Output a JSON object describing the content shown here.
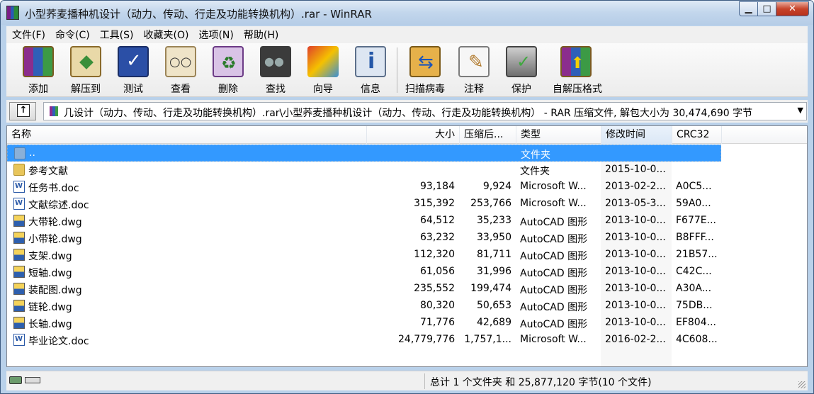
{
  "window": {
    "title": "小型荞麦播种机设计（动力、传动、行走及功能转换机构）.rar - WinRAR",
    "minimize": "▁",
    "maximize": "□",
    "close": "✕"
  },
  "menu": [
    "文件(F)",
    "命令(C)",
    "工具(S)",
    "收藏夹(O)",
    "选项(N)",
    "帮助(H)"
  ],
  "toolbar": [
    {
      "label": "添加",
      "icon": "add-archive-icon"
    },
    {
      "label": "解压到",
      "icon": "extract-icon"
    },
    {
      "label": "测试",
      "icon": "test-icon"
    },
    {
      "label": "查看",
      "icon": "view-icon"
    },
    {
      "label": "删除",
      "icon": "delete-icon"
    },
    {
      "label": "查找",
      "icon": "find-icon"
    },
    {
      "label": "向导",
      "icon": "wizard-icon"
    },
    {
      "label": "信息",
      "icon": "info-icon"
    },
    {
      "label": "扫描病毒",
      "icon": "scan-icon"
    },
    {
      "label": "注释",
      "icon": "comment-icon"
    },
    {
      "label": "保护",
      "icon": "protect-icon"
    },
    {
      "label": "自解压格式",
      "icon": "sfx-icon"
    }
  ],
  "address": {
    "path": "几设计（动力、传动、行走及功能转换机构）.rar\\小型荞麦播种机设计（动力、传动、行走及功能转换机构） - RAR 压缩文件, 解包大小为 30,474,690 字节"
  },
  "columns": {
    "name": "名称",
    "size": "大小",
    "packed": "压缩后...",
    "type": "类型",
    "modified": "修改时间",
    "crc": "CRC32"
  },
  "files": [
    {
      "name": "..",
      "size": "",
      "packed": "",
      "type": "文件夹",
      "modified": "",
      "crc": "",
      "kind": "folder-up"
    },
    {
      "name": "参考文献",
      "size": "",
      "packed": "",
      "type": "文件夹",
      "modified": "2015-10-0...",
      "crc": "",
      "kind": "folder"
    },
    {
      "name": "任务书.doc",
      "size": "93,184",
      "packed": "9,924",
      "type": "Microsoft W...",
      "modified": "2013-02-2...",
      "crc": "A0C5...",
      "kind": "doc"
    },
    {
      "name": "文献综述.doc",
      "size": "315,392",
      "packed": "253,766",
      "type": "Microsoft W...",
      "modified": "2013-05-3...",
      "crc": "59A0...",
      "kind": "doc"
    },
    {
      "name": "大带轮.dwg",
      "size": "64,512",
      "packed": "35,233",
      "type": "AutoCAD 图形",
      "modified": "2013-10-0...",
      "crc": "F677E...",
      "kind": "dwg"
    },
    {
      "name": "小带轮.dwg",
      "size": "63,232",
      "packed": "33,950",
      "type": "AutoCAD 图形",
      "modified": "2013-10-0...",
      "crc": "B8FFF...",
      "kind": "dwg"
    },
    {
      "name": "支架.dwg",
      "size": "112,320",
      "packed": "81,711",
      "type": "AutoCAD 图形",
      "modified": "2013-10-0...",
      "crc": "21B57...",
      "kind": "dwg"
    },
    {
      "name": "短轴.dwg",
      "size": "61,056",
      "packed": "31,996",
      "type": "AutoCAD 图形",
      "modified": "2013-10-0...",
      "crc": "C42C...",
      "kind": "dwg"
    },
    {
      "name": "装配图.dwg",
      "size": "235,552",
      "packed": "199,474",
      "type": "AutoCAD 图形",
      "modified": "2013-10-0...",
      "crc": "A30A...",
      "kind": "dwg"
    },
    {
      "name": "链轮.dwg",
      "size": "80,320",
      "packed": "50,653",
      "type": "AutoCAD 图形",
      "modified": "2013-10-0...",
      "crc": "75DB...",
      "kind": "dwg"
    },
    {
      "name": "长轴.dwg",
      "size": "71,776",
      "packed": "42,689",
      "type": "AutoCAD 图形",
      "modified": "2013-10-0...",
      "crc": "EF804...",
      "kind": "dwg"
    },
    {
      "name": "毕业论文.doc",
      "size": "24,779,776",
      "packed": "1,757,1...",
      "type": "Microsoft W...",
      "modified": "2016-02-2...",
      "crc": "4C608...",
      "kind": "doc"
    }
  ],
  "status": {
    "summary": "总计 1 个文件夹 和 25,877,120 字节(10 个文件)"
  }
}
